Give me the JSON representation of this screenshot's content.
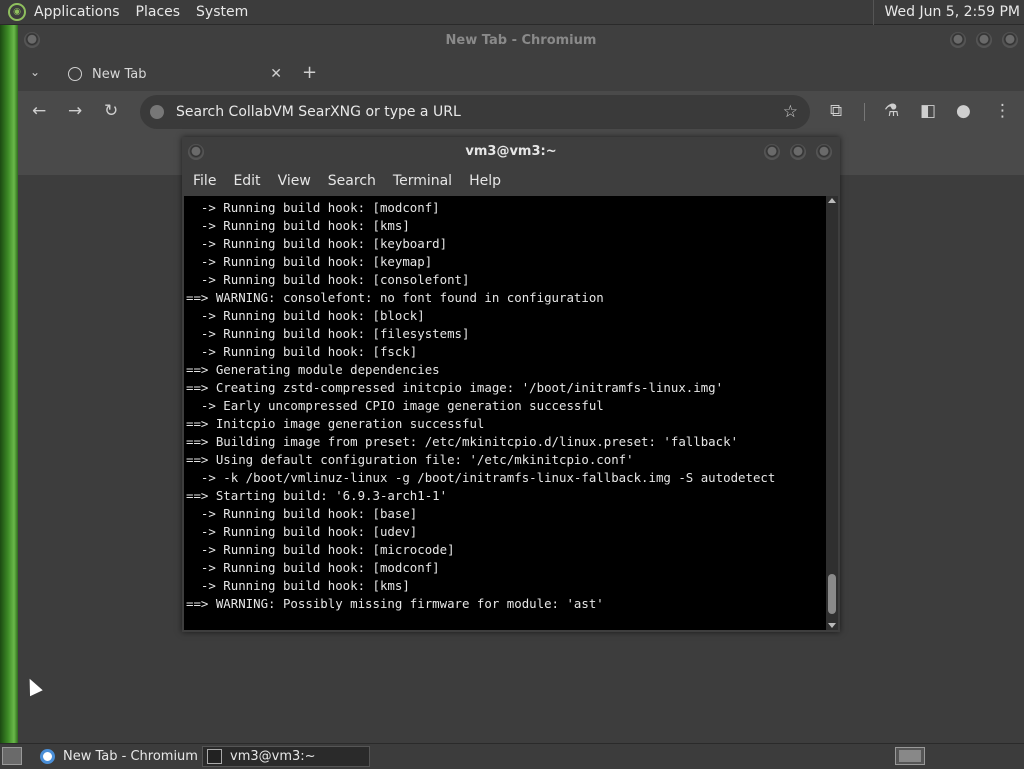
{
  "top_panel": {
    "menus": [
      "Applications",
      "Places",
      "System"
    ],
    "clock": "Wed Jun  5,  2:59 PM"
  },
  "chromium": {
    "window_title": "New Tab - Chromium",
    "tab_title": "New Tab",
    "omnibox_placeholder": "Search CollabVM SearXNG or type a URL"
  },
  "terminal": {
    "window_title": "vm3@vm3:~",
    "menu": [
      "File",
      "Edit",
      "View",
      "Search",
      "Terminal",
      "Help"
    ],
    "lines": [
      "  -> Running build hook: [modconf]",
      "  -> Running build hook: [kms]",
      "  -> Running build hook: [keyboard]",
      "  -> Running build hook: [keymap]",
      "  -> Running build hook: [consolefont]",
      "==> WARNING: consolefont: no font found in configuration",
      "  -> Running build hook: [block]",
      "  -> Running build hook: [filesystems]",
      "  -> Running build hook: [fsck]",
      "==> Generating module dependencies",
      "==> Creating zstd-compressed initcpio image: '/boot/initramfs-linux.img'",
      "  -> Early uncompressed CPIO image generation successful",
      "==> Initcpio image generation successful",
      "==> Building image from preset: /etc/mkinitcpio.d/linux.preset: 'fallback'",
      "==> Using default configuration file: '/etc/mkinitcpio.conf'",
      "  -> -k /boot/vmlinuz-linux -g /boot/initramfs-linux-fallback.img -S autodetect",
      "==> Starting build: '6.9.3-arch1-1'",
      "  -> Running build hook: [base]",
      "  -> Running build hook: [udev]",
      "  -> Running build hook: [microcode]",
      "  -> Running build hook: [modconf]",
      "  -> Running build hook: [kms]",
      "==> WARNING: Possibly missing firmware for module: 'ast'"
    ]
  },
  "taskbar": {
    "tasks": [
      "New Tab - Chromium",
      "vm3@vm3:~"
    ]
  },
  "colors": {
    "panel_bg": "#3c3c3c",
    "terminal_bg": "#000000",
    "terminal_fg": "#e6e6e6",
    "chromium_bg": "#4a4a4a"
  }
}
